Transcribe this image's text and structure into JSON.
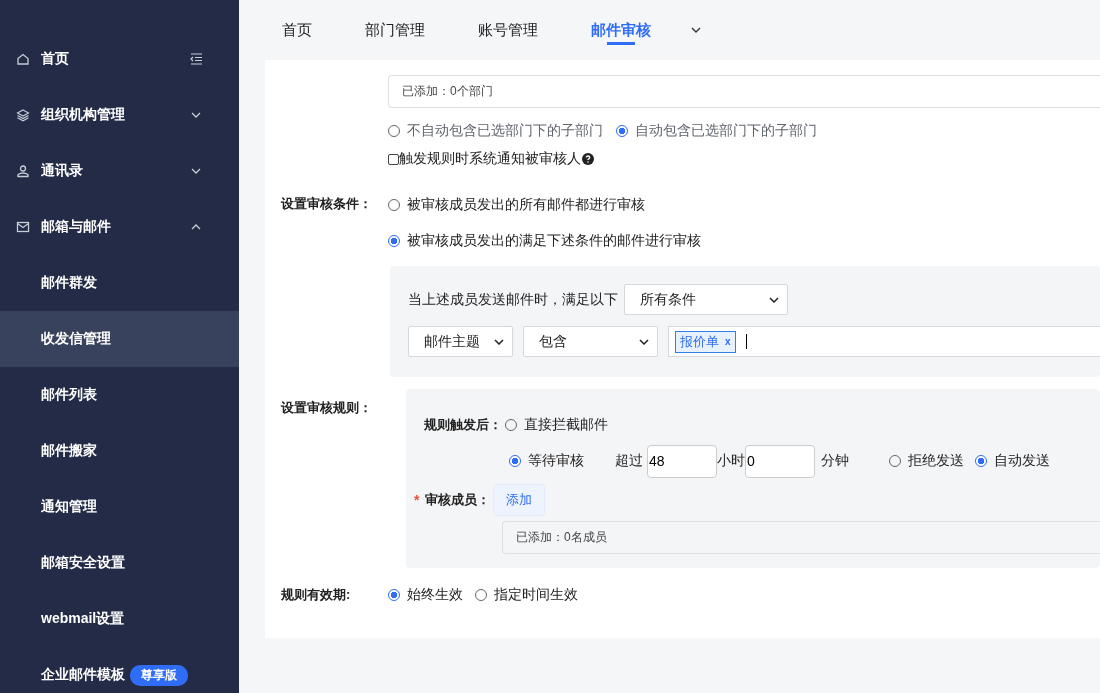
{
  "sidebar": {
    "items": [
      {
        "label": "首页"
      },
      {
        "label": "组织机构管理",
        "expanded": false
      },
      {
        "label": "通讯录",
        "expanded": false
      },
      {
        "label": "邮箱与邮件",
        "expanded": true,
        "children": [
          {
            "label": "邮件群发",
            "selected": false
          },
          {
            "label": "收发信管理",
            "selected": true
          },
          {
            "label": "邮件列表",
            "selected": false
          },
          {
            "label": "邮件搬家",
            "selected": false
          },
          {
            "label": "通知管理",
            "selected": false
          },
          {
            "label": "邮箱安全设置",
            "selected": false
          },
          {
            "label": "webmail设置",
            "selected": false
          },
          {
            "label": "企业邮件模板",
            "selected": false,
            "badge": "尊享版"
          }
        ]
      }
    ]
  },
  "tabs": [
    {
      "label": "首页",
      "selected": false
    },
    {
      "label": "部门管理",
      "selected": false
    },
    {
      "label": "账号管理",
      "selected": false
    },
    {
      "label": "邮件审核",
      "selected": true
    }
  ],
  "form": {
    "department_box": "已添加：0个部门",
    "subdepartment_options": [
      {
        "label": "不自动包含已选部门下的子部门",
        "selected": false
      },
      {
        "label": "自动包含已选部门下的子部门",
        "selected": true
      }
    ],
    "notify": {
      "label": "触发规则时系统通知被审核人",
      "checked": false
    },
    "conditions": {
      "label": "设置审核条件：",
      "options": [
        {
          "label": "被审核成员发出的所有邮件都进行审核",
          "selected": false
        },
        {
          "label": "被审核成员发出的满足下述条件的邮件进行审核",
          "selected": true
        }
      ],
      "panel": {
        "prefix": "当上述成员发送邮件时，满足以下",
        "match_select": "所有条件",
        "field_select": "邮件主题",
        "operator_select": "包含",
        "tags": [
          {
            "label": "报价单",
            "remove": "x"
          }
        ]
      }
    },
    "rules": {
      "label": "设置审核规则：",
      "trigger_label": "规则触发后：",
      "actions": [
        {
          "label": "直接拦截邮件",
          "selected": false
        },
        {
          "label": "等待审核",
          "selected": true
        }
      ],
      "timeout": {
        "prefix": "超过",
        "hours": "48",
        "hours_unit": "小时",
        "minutes": "0",
        "minutes_unit": "分钟",
        "outcomes": [
          {
            "label": "拒绝发送",
            "selected": false
          },
          {
            "label": "自动发送",
            "selected": true
          }
        ]
      },
      "reviewers": {
        "required_mark": "*",
        "label": "审核成员：",
        "add_button": "添加",
        "box": "已添加：0名成员"
      }
    },
    "validity": {
      "label": "规则有效期:",
      "options": [
        {
          "label": "始终生效",
          "selected": true
        },
        {
          "label": "指定时间生效",
          "selected": false
        }
      ]
    }
  }
}
